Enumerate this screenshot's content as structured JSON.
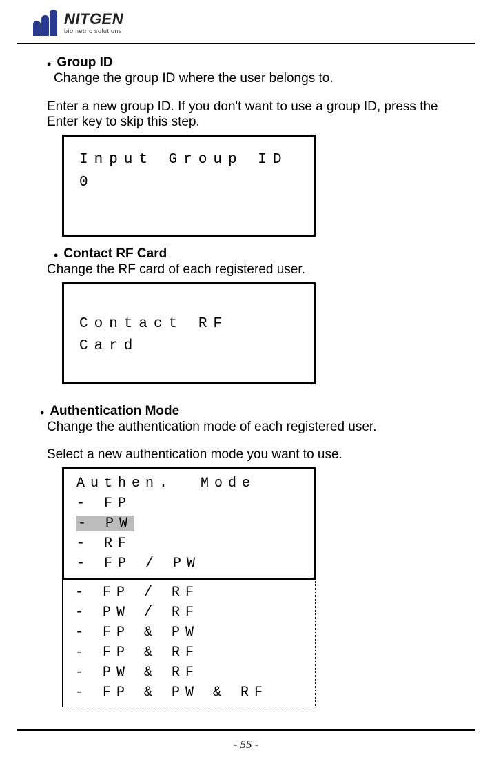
{
  "brand": {
    "name": "NITGEN",
    "sub": "biometric solutions"
  },
  "sections": {
    "group": {
      "title": "Group ID",
      "line1": "Change the group ID where the user belongs to.",
      "line2": "Enter a new group ID. If you don't want to use a group ID, press the Enter key to skip this step.",
      "lcd_l1": "Input Group ID",
      "lcd_l2": "0"
    },
    "rf": {
      "title": "Contact RF Card",
      "line1": "Change the RF card of each registered user.",
      "lcd_l1": "Contact RF Card"
    },
    "auth": {
      "title": "Authentication Mode",
      "line1": "Change the authentication mode of each registered user.",
      "line2": "Select a new authentication mode you want to use.",
      "lcd_title": "Authen.  Mode",
      "items1": [
        "- FP",
        "- PW",
        "- RF",
        "- FP / PW"
      ],
      "selected_index": 1,
      "items2": [
        "- FP / RF",
        "- PW / RF",
        "- FP & PW",
        "- FP & RF",
        "- PW & RF",
        "- FP & PW & RF"
      ]
    }
  },
  "page": "- 55 -"
}
